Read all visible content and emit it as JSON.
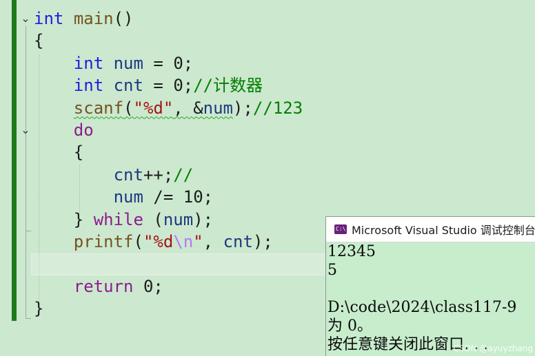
{
  "editor": {
    "lines": [
      [
        {
          "t": "int",
          "c": "kw"
        },
        {
          "t": " ",
          "c": "punc"
        },
        {
          "t": "main",
          "c": "fn"
        },
        {
          "t": "()",
          "c": "punc"
        }
      ],
      [
        {
          "t": "{",
          "c": "punc"
        }
      ],
      [
        {
          "t": "    ",
          "c": "punc"
        },
        {
          "t": "int",
          "c": "kw"
        },
        {
          "t": " ",
          "c": "punc"
        },
        {
          "t": "num",
          "c": "var"
        },
        {
          "t": " = 0;",
          "c": "punc"
        }
      ],
      [
        {
          "t": "    ",
          "c": "punc"
        },
        {
          "t": "int",
          "c": "kw"
        },
        {
          "t": " ",
          "c": "punc"
        },
        {
          "t": "cnt",
          "c": "var"
        },
        {
          "t": " = 0;",
          "c": "punc"
        },
        {
          "t": "//计数器",
          "c": "cmt"
        }
      ],
      [
        {
          "t": "    ",
          "c": "punc"
        },
        {
          "t": "scanf",
          "c": "fn squiggle"
        },
        {
          "t": "(",
          "c": "punc squiggle"
        },
        {
          "t": "\"%d\"",
          "c": "str squiggle"
        },
        {
          "t": ", &",
          "c": "punc squiggle"
        },
        {
          "t": "num",
          "c": "var squiggle"
        },
        {
          "t": ");",
          "c": "punc"
        },
        {
          "t": "//123",
          "c": "cmt"
        }
      ],
      [
        {
          "t": "    ",
          "c": "punc"
        },
        {
          "t": "do",
          "c": "kwc"
        }
      ],
      [
        {
          "t": "    {",
          "c": "punc"
        }
      ],
      [
        {
          "t": "        ",
          "c": "punc"
        },
        {
          "t": "cnt",
          "c": "var"
        },
        {
          "t": "++;",
          "c": "punc"
        },
        {
          "t": "//",
          "c": "cmt"
        }
      ],
      [
        {
          "t": "        ",
          "c": "punc"
        },
        {
          "t": "num",
          "c": "var"
        },
        {
          "t": " /= 10;",
          "c": "punc"
        }
      ],
      [
        {
          "t": "    } ",
          "c": "punc"
        },
        {
          "t": "while",
          "c": "kwc"
        },
        {
          "t": " (",
          "c": "punc"
        },
        {
          "t": "num",
          "c": "var"
        },
        {
          "t": ");",
          "c": "punc"
        }
      ],
      [
        {
          "t": "    ",
          "c": "punc"
        },
        {
          "t": "printf",
          "c": "fn"
        },
        {
          "t": "(",
          "c": "punc"
        },
        {
          "t": "\"%d",
          "c": "str"
        },
        {
          "t": "\\n",
          "c": "esc"
        },
        {
          "t": "\"",
          "c": "str"
        },
        {
          "t": ", ",
          "c": "punc"
        },
        {
          "t": "cnt",
          "c": "var"
        },
        {
          "t": ");",
          "c": "punc"
        }
      ],
      [],
      [
        {
          "t": "    ",
          "c": "punc"
        },
        {
          "t": "return",
          "c": "kwc"
        },
        {
          "t": " 0;",
          "c": "punc"
        }
      ],
      [
        {
          "t": "}",
          "c": "punc"
        }
      ]
    ]
  },
  "console": {
    "icon_label": "C:\\",
    "title": "Microsoft Visual Studio 调试控制台",
    "output": [
      "12345",
      "5",
      "",
      "D:\\code\\2024\\class117-9",
      "为 0。",
      "按任意键关闭此窗口. . ."
    ]
  },
  "watermark": "CSDN @ayuyzhang",
  "icons": {
    "fold_toggle": "chevron-down-icon",
    "console_app": "console-app-icon"
  },
  "colors": {
    "background": "#cce8cf",
    "keyword": "#1d1dde",
    "control_keyword": "#8c1c8c",
    "function": "#74531f",
    "variable": "#1f377f",
    "string": "#a31515",
    "comment": "#008000",
    "change_bar": "#1d7a1d"
  }
}
